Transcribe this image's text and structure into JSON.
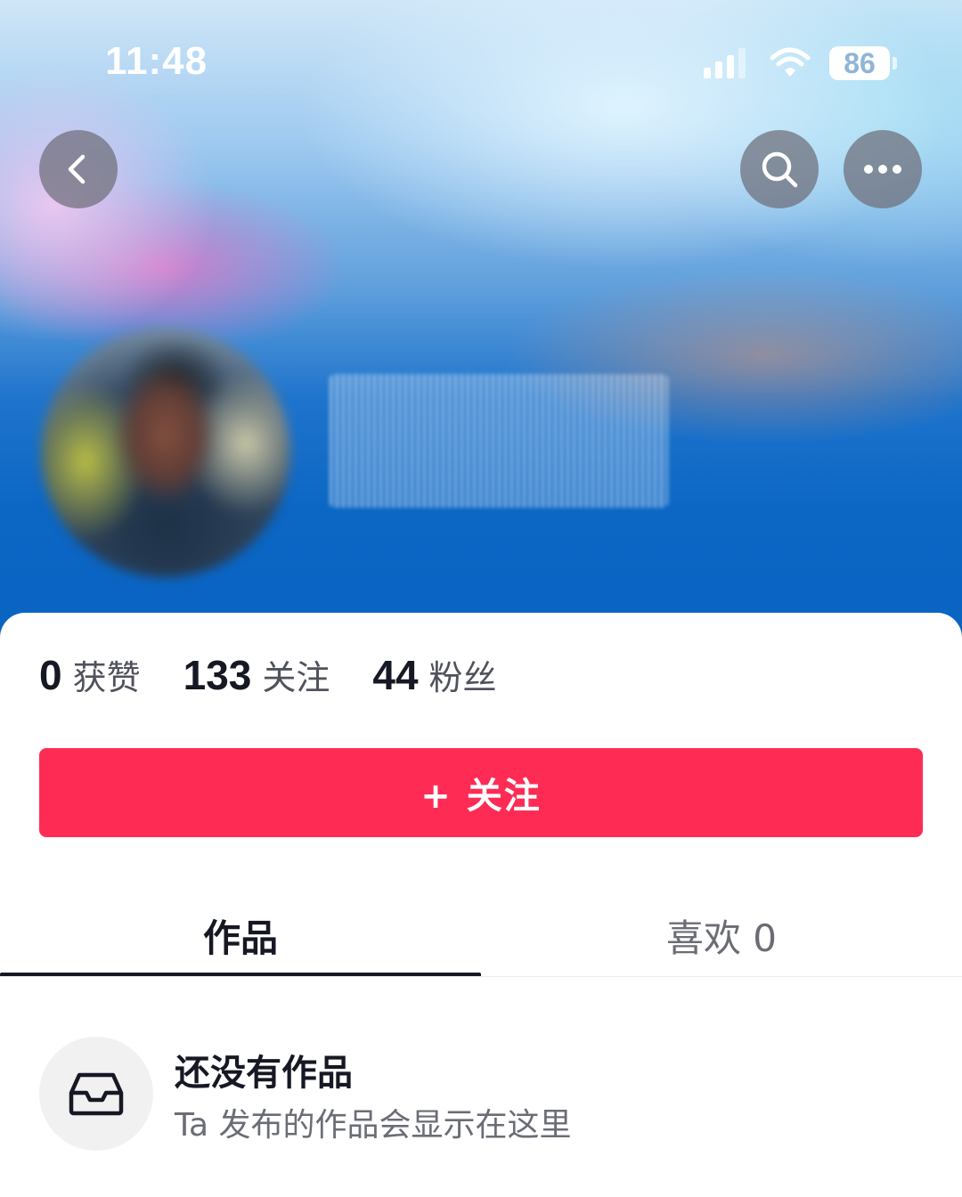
{
  "status_bar": {
    "time": "11:48",
    "battery": "86",
    "icons": [
      "signal-icon",
      "wifi-icon",
      "battery-icon"
    ]
  },
  "nav": {
    "back_icon": "chevron-left-icon",
    "search_icon": "search-icon",
    "more_icon": "more-icon"
  },
  "profile": {
    "avatar_icon": "avatar"
  },
  "stats": [
    {
      "value": "0",
      "label": "获赞"
    },
    {
      "value": "133",
      "label": "关注"
    },
    {
      "value": "44",
      "label": "粉丝"
    }
  ],
  "follow_button": {
    "label": "+ 关注",
    "color": "#fe2c55"
  },
  "tabs": [
    {
      "label": "作品",
      "active": true
    },
    {
      "label": "喜欢 0",
      "active": false
    }
  ],
  "empty_state": {
    "icon": "inbox-icon",
    "title": "还没有作品",
    "subtitle": "Ta 发布的作品会显示在这里"
  },
  "colors": {
    "primary_text": "#161823",
    "secondary_text": "#6b6d75",
    "accent": "#fe2c55"
  }
}
